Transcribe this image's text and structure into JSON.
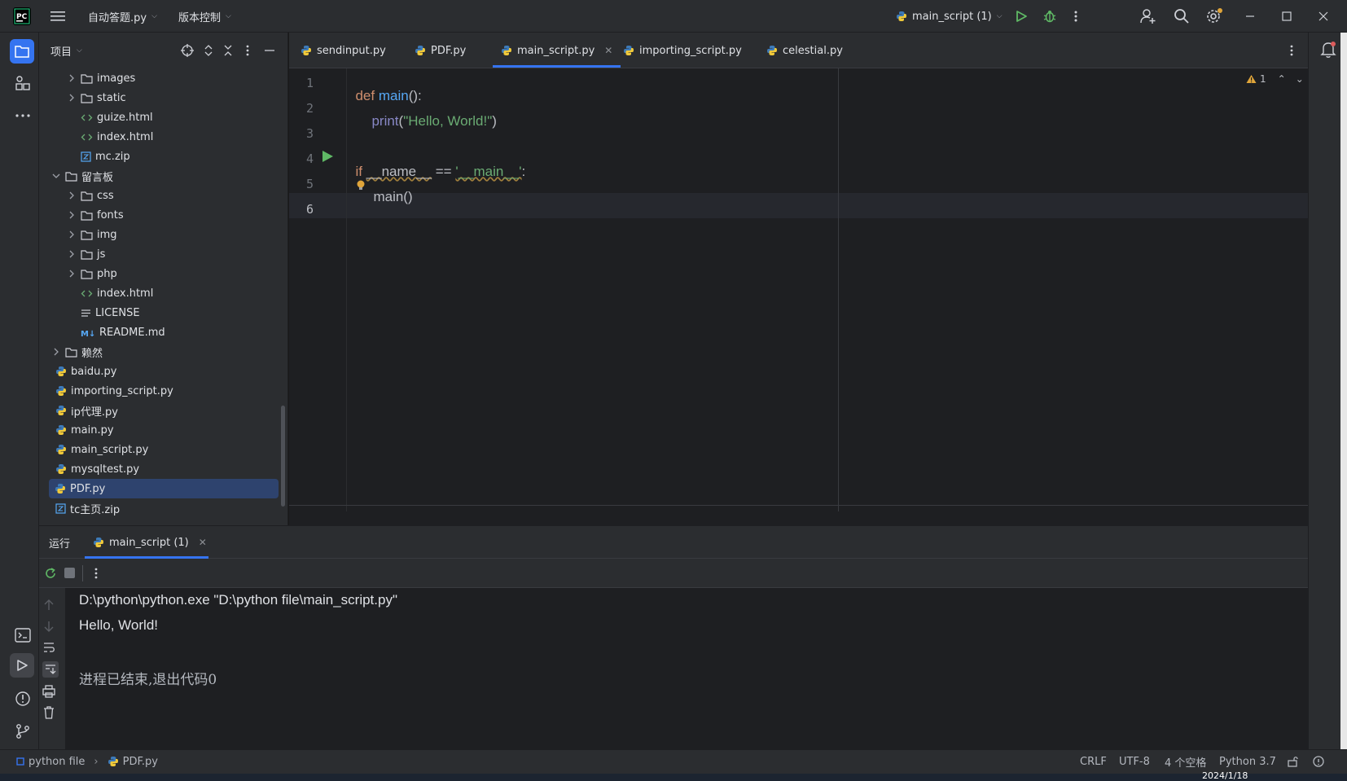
{
  "titlebar": {
    "project_menu": "自动答题.py",
    "vcs_menu": "版本控制",
    "run_config": "main_script (1)"
  },
  "project_panel": {
    "title": "项目",
    "tree": [
      {
        "label": "images",
        "type": "folder",
        "expanded": false
      },
      {
        "label": "static",
        "type": "folder",
        "expanded": false
      },
      {
        "label": "guize.html",
        "type": "html"
      },
      {
        "label": "index.html",
        "type": "html"
      },
      {
        "label": "mc.zip",
        "type": "zip"
      },
      {
        "label": "留言板",
        "type": "folder",
        "expanded": true
      },
      {
        "label": "css",
        "type": "folder",
        "expanded": false
      },
      {
        "label": "fonts",
        "type": "folder",
        "expanded": false
      },
      {
        "label": "img",
        "type": "folder",
        "expanded": false
      },
      {
        "label": "js",
        "type": "folder",
        "expanded": false
      },
      {
        "label": "php",
        "type": "folder",
        "expanded": false
      },
      {
        "label": "index.html",
        "type": "html"
      },
      {
        "label": "LICENSE",
        "type": "text"
      },
      {
        "label": "README.md",
        "type": "md"
      },
      {
        "label": "赖然",
        "type": "folder",
        "expanded": false
      },
      {
        "label": "baidu.py",
        "type": "py"
      },
      {
        "label": "importing_script.py",
        "type": "py"
      },
      {
        "label": "ip代理.py",
        "type": "py"
      },
      {
        "label": "main.py",
        "type": "py"
      },
      {
        "label": "main_script.py",
        "type": "py"
      },
      {
        "label": "mysqltest.py",
        "type": "py"
      },
      {
        "label": "PDF.py",
        "type": "py",
        "selected": true
      },
      {
        "label": "tc主页.zip",
        "type": "zip"
      }
    ]
  },
  "editor": {
    "tabs": [
      {
        "label": "sendinput.py"
      },
      {
        "label": "PDF.py"
      },
      {
        "label": "main_script.py",
        "active": true
      },
      {
        "label": "importing_script.py"
      },
      {
        "label": "celestial.py"
      }
    ],
    "line_numbers": [
      "1",
      "2",
      "3",
      "4",
      "5",
      "6"
    ],
    "code": {
      "l1_def": "def",
      "l1_name": "main",
      "l1_rest": "():",
      "l2_print": "print",
      "l2_open": "(",
      "l2_str": "\"Hello, World!\"",
      "l2_close": ")",
      "l4_if": "if",
      "l4_name": "__name__",
      "l4_eq": " == ",
      "l4_str": "'__main__'",
      "l4_colon": ":",
      "l5_call": "main()"
    },
    "warning_count": "1"
  },
  "run_panel": {
    "title": "运行",
    "tab": "main_script (1)",
    "output": [
      "D:\\python\\python.exe \"D:\\python file\\main_script.py\"",
      "Hello, World!",
      "",
      "进程已结束,退出代码0"
    ]
  },
  "statusbar": {
    "breadcrumb_root": "python file",
    "breadcrumb_file": "PDF.py",
    "line_ending": "CRLF",
    "encoding": "UTF-8",
    "indent": "4 个空格",
    "interpreter": "Python 3.7",
    "clock": "2024/1/18"
  },
  "colors": {
    "accent": "#3574f0",
    "run_green": "#5fb865",
    "selection": "#2e436e",
    "warning": "#e0a53a"
  }
}
